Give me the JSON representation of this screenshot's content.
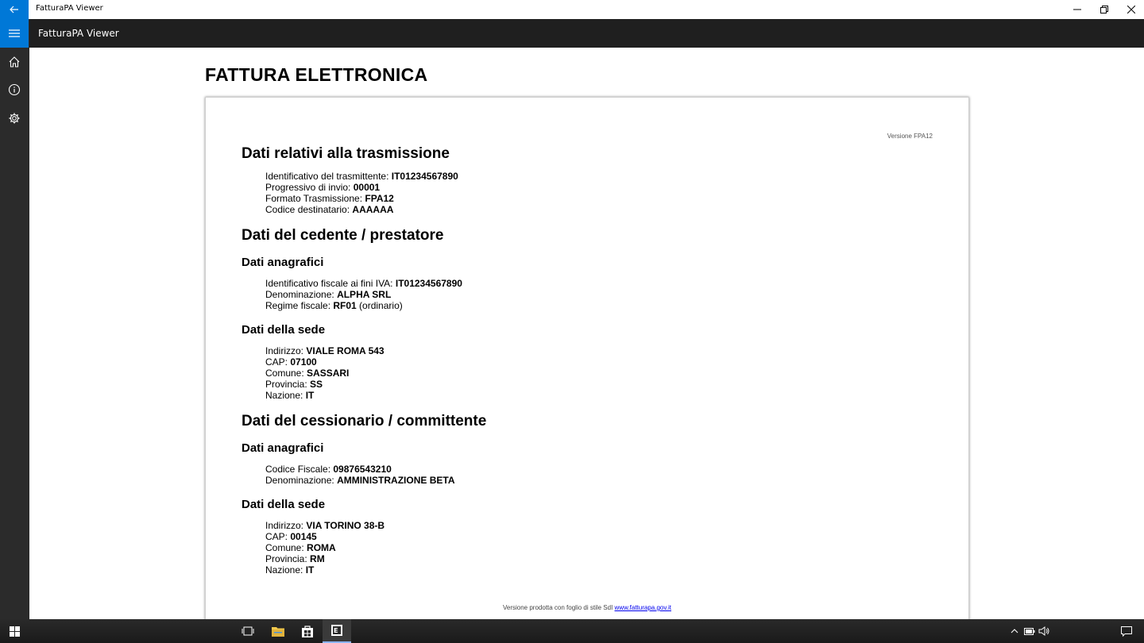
{
  "window": {
    "title": "FatturaPA Viewer"
  },
  "appbar": {
    "title": "FatturaPA Viewer"
  },
  "document": {
    "title": "FATTURA ELETTRONICA",
    "version": "Versione FPA12",
    "trasmissione": {
      "heading": "Dati relativi alla trasmissione",
      "fields": [
        {
          "label": "Identificativo del trasmittente: ",
          "value": "IT01234567890"
        },
        {
          "label": "Progressivo di invio: ",
          "value": "00001"
        },
        {
          "label": "Formato Trasmissione: ",
          "value": "FPA12"
        },
        {
          "label": "Codice destinatario: ",
          "value": "AAAAAA"
        }
      ]
    },
    "cedente": {
      "heading": "Dati del cedente / prestatore",
      "anagrafici_heading": "Dati anagrafici",
      "anagrafici": [
        {
          "label": "Identificativo fiscale ai fini IVA: ",
          "value": "IT01234567890",
          "suffix": ""
        },
        {
          "label": "Denominazione: ",
          "value": "ALPHA SRL",
          "suffix": ""
        },
        {
          "label": "Regime fiscale: ",
          "value": "RF01",
          "suffix": " (ordinario)"
        }
      ],
      "sede_heading": "Dati della sede",
      "sede": [
        {
          "label": "Indirizzo: ",
          "value": "VIALE ROMA 543"
        },
        {
          "label": "CAP: ",
          "value": "07100"
        },
        {
          "label": "Comune: ",
          "value": "SASSARI"
        },
        {
          "label": "Provincia: ",
          "value": "SS"
        },
        {
          "label": "Nazione: ",
          "value": "IT"
        }
      ]
    },
    "cessionario": {
      "heading": "Dati del cessionario / committente",
      "anagrafici_heading": "Dati anagrafici",
      "anagrafici": [
        {
          "label": "Codice Fiscale: ",
          "value": "09876543210"
        },
        {
          "label": "Denominazione: ",
          "value": "AMMINISTRAZIONE BETA"
        }
      ],
      "sede_heading": "Dati della sede",
      "sede": [
        {
          "label": "Indirizzo: ",
          "value": "VIA TORINO 38-B"
        },
        {
          "label": "CAP: ",
          "value": "00145"
        },
        {
          "label": "Comune: ",
          "value": "ROMA"
        },
        {
          "label": "Provincia: ",
          "value": "RM"
        },
        {
          "label": "Nazione: ",
          "value": "IT"
        }
      ]
    },
    "footer": {
      "text": "Versione prodotta con foglio di stile SdI ",
      "link": "www.fatturapa.gov.it"
    }
  },
  "colors": {
    "accent": "#0078d7",
    "appbar": "#1f1f1f",
    "nav": "#2b2b2b"
  },
  "icons": {
    "nav": [
      "hamburger-icon",
      "home-icon",
      "info-icon",
      "settings-icon"
    ],
    "taskbar": [
      "windows-start-icon",
      "task-view-icon",
      "file-explorer-icon",
      "store-icon",
      "fatturapa-app-icon"
    ],
    "tray": [
      "chevron-up-icon",
      "battery-icon",
      "volume-icon",
      "notification-icon"
    ]
  }
}
